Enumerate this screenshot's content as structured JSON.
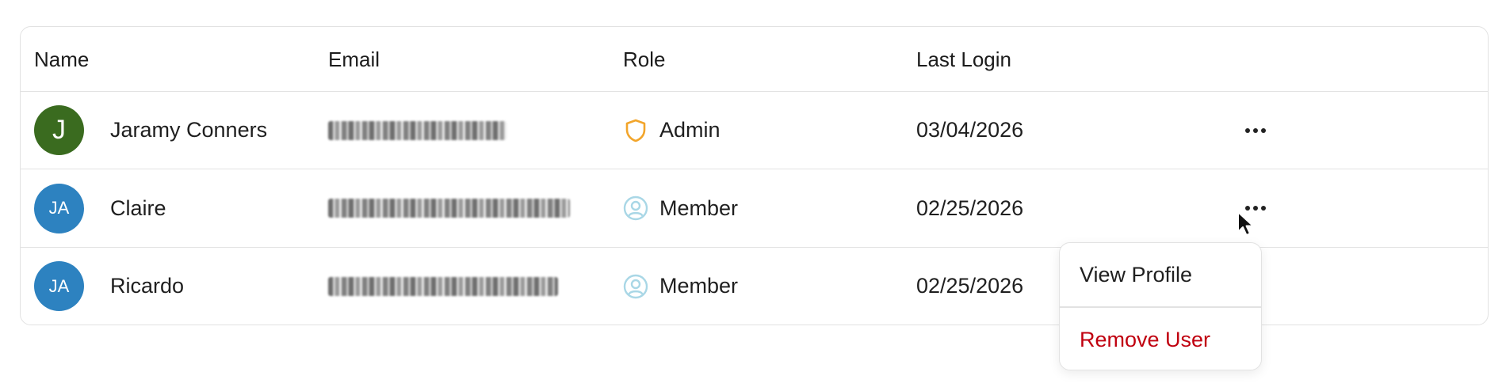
{
  "table": {
    "columns": [
      "Name",
      "Email",
      "Role",
      "Last Login"
    ],
    "rows": [
      {
        "avatar_text": "J",
        "avatar_color": "#3a6b1f",
        "name": "Jaramy Conners",
        "role": "Admin",
        "role_icon": "shield-icon",
        "role_icon_color": "#f2a52b",
        "last_login": "03/04/2026"
      },
      {
        "avatar_text": "JA",
        "avatar_color": "#2d82c0",
        "name": "Claire",
        "role": "Member",
        "role_icon": "user-circle-icon",
        "role_icon_color": "#a9d7e6",
        "last_login": "02/25/2026"
      },
      {
        "avatar_text": "JA",
        "avatar_color": "#2d82c0",
        "name": "Ricardo",
        "role": "Member",
        "role_icon": "user-circle-icon",
        "role_icon_color": "#a9d7e6",
        "last_login": "02/25/2026"
      }
    ]
  },
  "row_menu": {
    "items": [
      "View Profile",
      "Remove User"
    ],
    "danger_color": "#c0000f"
  }
}
